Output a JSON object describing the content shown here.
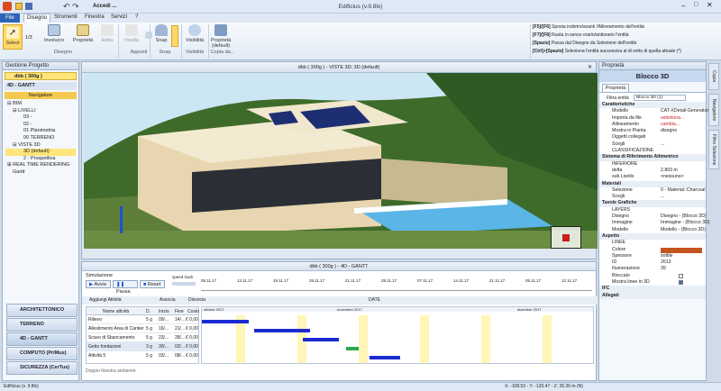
{
  "window": {
    "title": "Edificius (v.9.8lx)",
    "quick_label": "Accedi ..."
  },
  "tabs": [
    {
      "label": "File"
    },
    {
      "label": "Disegno"
    },
    {
      "label": "Strumenti"
    },
    {
      "label": "Finestra"
    },
    {
      "label": "Servizi"
    },
    {
      "label": "?"
    }
  ],
  "ribbon": {
    "buttons": [
      {
        "label": "Select"
      },
      {
        "label": "Involucro"
      },
      {
        "label": "Proprietà"
      },
      {
        "label": "Edita"
      },
      {
        "label": "Incolla"
      },
      {
        "label": "Copia"
      },
      {
        "label": "Snap"
      },
      {
        "label": "Visibilità"
      },
      {
        "label": "Proprietà (default)"
      }
    ],
    "counter": "1/3",
    "groups": [
      {
        "label": "Disegno"
      },
      {
        "label": "Appunti"
      },
      {
        "label": "Snap"
      },
      {
        "label": "Visibilità"
      },
      {
        "label": "Copia da..."
      }
    ],
    "hints": [
      {
        "key": "[F5]/[F6]",
        "text": "Sposta indietro/avanti l'Allineamento dell'entità"
      },
      {
        "key": "[F7]/[F8]",
        "text": "Ruota in senso orario/antiorario l'entità"
      },
      {
        "key": "[Spazio]",
        "text": "Passa dal Disegno da Selezione dell'entità"
      },
      {
        "key": "[Ctrl]+[Spazio]",
        "text": "Seleziona l'entità successiva al di sotto di quella attuale (*)"
      }
    ]
  },
  "project": {
    "header": "Gestione Progetto",
    "root": "dbb ( 300g )",
    "section": "4D - GANTT",
    "nav_header": "Navigatore",
    "tree": [
      {
        "label": "BIM",
        "level": 0
      },
      {
        "label": "LIVELLI",
        "level": 1
      },
      {
        "label": "03 -",
        "level": 2
      },
      {
        "label": "02 -",
        "level": 2
      },
      {
        "label": "01 Planimetria",
        "level": 2
      },
      {
        "label": "00 TERRENO",
        "level": 2
      },
      {
        "label": "VISTE 3D",
        "level": 1
      },
      {
        "label": "3D (default)",
        "level": 2,
        "selected": true
      },
      {
        "label": "2 - Prospettiva",
        "level": 2
      },
      {
        "label": "REAL TIME RENDERING",
        "level": 0
      },
      {
        "label": "Gantt",
        "level": 0
      }
    ],
    "nav_buttons": [
      {
        "label": "ARCHITETTONICO"
      },
      {
        "label": "TERRENO"
      },
      {
        "label": "4D - GANTT"
      },
      {
        "label": "COMPUTO (PriMus)"
      },
      {
        "label": "SICUREZZA (CerTus)"
      }
    ]
  },
  "view3d": {
    "title": "dbb ( 300g ) - VISTE 3D: 3D (default)"
  },
  "gantt": {
    "title": "dbb ( 300g ) - 4D - GANTT",
    "sim_label": "Simulazione",
    "controls": [
      {
        "label": "Avvia"
      },
      {
        "label": "Pausa"
      },
      {
        "label": "Reset"
      }
    ],
    "speed_label": "speed track",
    "timeline_dates": [
      "05.11.17",
      "12.11.17",
      "19.11.17",
      "26.11.17",
      "21.11.17",
      "28.11.17",
      "07.11.17",
      "14.11.17",
      "21.11.17",
      "05.11.17",
      "12.11.17"
    ],
    "toolbar": {
      "add": "Aggiungi Attività",
      "assoc": "Associa",
      "dissoc": "Dissocia",
      "date": "DATE"
    },
    "columns": [
      "Nome attività",
      "D.",
      "Inizio",
      "Fine",
      "Costo"
    ],
    "months": [
      "ottobre 2017",
      "novembre 2017",
      "dicembre 2017"
    ],
    "rows": [
      {
        "name": "Rilievo",
        "dur": "5 g",
        "start": "09/...",
        "end": "14/...",
        "cost": "€ 0,00"
      },
      {
        "name": "Allestimento Area di Cantiere",
        "dur": "5 g",
        "start": "16/...",
        "end": "21/...",
        "cost": "€ 0,00"
      },
      {
        "name": "Scavo di Sbancamento",
        "dur": "5 g",
        "start": "23/...",
        "end": "28/...",
        "cost": "€ 0,00"
      },
      {
        "name": "Getto fondazioni",
        "dur": "3 g",
        "start": "30/...",
        "end": "02/...",
        "cost": "€ 0,00"
      },
      {
        "name": "Attività 5",
        "dur": "5 g",
        "start": "03/...",
        "end": "08/...",
        "cost": "€ 0,00"
      }
    ],
    "footer": "Doppio finestra ambiente"
  },
  "properties": {
    "header": "Proprietà",
    "title": "Blocco 3D",
    "tab": "Proprietà",
    "filter_label": "Filtra entità",
    "filter_value": "Blocco 3D (1)",
    "sections": [
      {
        "title": "Caratteristiche",
        "rows": [
          {
            "k": "Modello",
            "v": "CAT-XDetail-Generator"
          },
          {
            "k": "Importa da file",
            "v": "seleziona..."
          },
          {
            "k": "Allineamento",
            "v": "cambia..."
          },
          {
            "k": "Mostra in Pianta",
            "v": "disegno"
          },
          {
            "k": "Oggetti collegati",
            "v": ""
          },
          {
            "k": "Scegli",
            "v": "..."
          },
          {
            "k": "CLASSIFICAZIONE",
            "v": ""
          }
        ]
      },
      {
        "title": "Sistema di Riferimento Altimetrico",
        "rows": [
          {
            "k": "INFERIORE",
            "v": ""
          },
          {
            "k": "delta",
            "v": "2.803 m"
          },
          {
            "k": "sub Livello",
            "v": "<nessuno>"
          }
        ]
      },
      {
        "title": "Materiali",
        "rows": [
          {
            "k": "Selezione",
            "v": "0 - Material::Charcoal"
          },
          {
            "k": "Scegli",
            "v": "..."
          }
        ]
      },
      {
        "title": "Tavole Grafiche",
        "rows": [
          {
            "k": "LAYERS",
            "v": ""
          },
          {
            "k": "Disegno",
            "v": "Disegno - (Blocco 3D)"
          },
          {
            "k": "Immagine",
            "v": "Immagine - (Blocco 3D)"
          },
          {
            "k": "Modello",
            "v": "Modello - (Blocco 3D)"
          }
        ]
      },
      {
        "title": "Aspetto",
        "rows": [
          {
            "k": "LINEE",
            "v": ""
          },
          {
            "k": "Colore",
            "v": ""
          },
          {
            "k": "Spessore",
            "v": "sottile"
          },
          {
            "k": "ID",
            "v": "2613"
          },
          {
            "k": "Numerazione",
            "v": "39"
          },
          {
            "k": "Bloccato",
            "v": ""
          },
          {
            "k": "Mostra linee in 3D",
            "v": ""
          }
        ]
      },
      {
        "title": "IFC",
        "rows": []
      },
      {
        "title": "Allegati",
        "rows": []
      }
    ],
    "side_tabs": [
      "Copia",
      "Navigatore",
      "Filtro Selezione"
    ]
  },
  "status": {
    "left": "Edificius (v. 9.8lx)",
    "right": "X: -108.53 - Y: -120.47 - Z: 26.26 m (N)"
  },
  "colors": {
    "accent": "#1a2bd0",
    "sky": "#cde6f4",
    "aspect_color": "#c4541e",
    "selection": "#ffe57a"
  }
}
